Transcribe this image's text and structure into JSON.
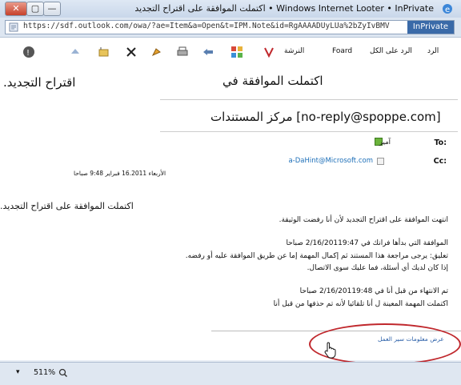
{
  "window": {
    "title": "اكتملت الموافقة على اقتراح التجديد • Windows Internet Looter • InPrivate",
    "buttons": [
      "✕",
      "▢",
      "—"
    ]
  },
  "address": {
    "url": "https://sdf.outlook.com/owa/?ae=Item&a=Open&t=IPM.Note&id=RgAAAADUyLUa%2bZyIvBMV",
    "inprivate": "InPrivate"
  },
  "toolbar": {
    "reply": "الرد",
    "reply_all": "الرد على الكل",
    "forward": "Foard",
    "print_label": "النرشة"
  },
  "message": {
    "subject_left": ".اقتراح التجديد",
    "subject_center": "اكتملت الموافقة في",
    "sender": "مركز المستندات [no-reply@spoppe.com]",
    "to_label": "To:",
    "to_value": "آمير",
    "cc_label": "Cc:",
    "cc_value": "a-DaHint@Microsoft.com",
    "timestamp": "الأربعاء 16.2011 فبراير 9:48 صباحا",
    "headline": ".اكتملت الموافقة على اقتراح التجديد",
    "body_lines": [
      "انتهت الموافقة على اقتراح التجديد لأن أنا رفضت الوثيقة.",
      "الموافقة التي بدأها فرانك في 2/16/20119:47 صباحا",
      "تعليق: يرجى مراجعة هذا المستند ثم إكمال المهمة إما عن طريق الموافقة عليه أو رفضه.",
      "إذا كان لديك أي أسئلة، فما عليك سوى الاتصال.",
      "تم الانتهاء من قبل أنا في 2/16/20119:48 صباحا",
      "اكتملت المهمة المعينة ل أنا تلقائيا لأنه تم حذفها من قبل أنا"
    ],
    "footer_link": "عرض معلومات سير العمل"
  },
  "status": {
    "zoom": "511% ",
    "zoom_caret": "▾"
  },
  "colors": {
    "accent": "#3a6aa8",
    "highlight": "#c0282d",
    "link": "#1d6fb8"
  }
}
